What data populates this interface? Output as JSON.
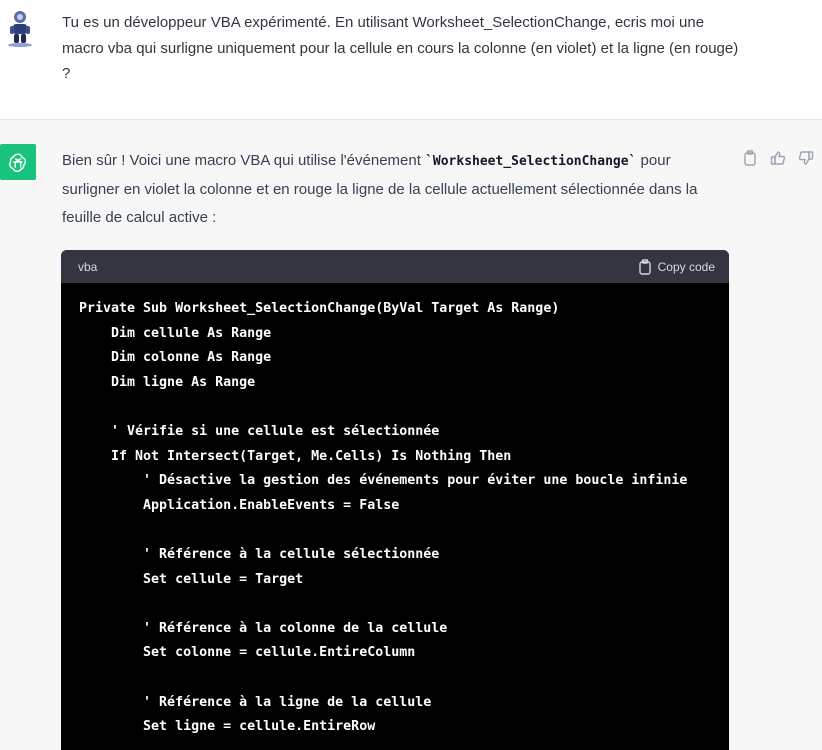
{
  "user_message": {
    "text": "Tu es un développeur VBA expérimenté. En utilisant Worksheet_SelectionChange, ecris moi une macro vba qui surligne uniquement pour la cellule en cours la colonne (en violet) et la ligne (en rouge) ?"
  },
  "assistant_message": {
    "intro_before": "Bien sûr ! Voici une macro VBA qui utilise l'événement ",
    "intro_code": "`Worksheet_SelectionChange`",
    "intro_after": " pour surligner en violet la colonne et en rouge la ligne de la cellule actuellement sélectionnée dans la feuille de calcul active :",
    "actions": [
      "copy-icon",
      "thumbs-up-icon",
      "thumbs-down-icon"
    ]
  },
  "code_block": {
    "language": "vba",
    "copy_label": "Copy code",
    "lines": [
      "Private Sub Worksheet_SelectionChange(ByVal Target As Range)",
      "    Dim cellule As Range",
      "    Dim colonne As Range",
      "    Dim ligne As Range",
      "",
      "    ' Vérifie si une cellule est sélectionnée",
      "    If Not Intersect(Target, Me.Cells) Is Nothing Then",
      "        ' Désactive la gestion des événements pour éviter une boucle infinie",
      "        Application.EnableEvents = False",
      "",
      "        ' Référence à la cellule sélectionnée",
      "        Set cellule = Target",
      "",
      "        ' Référence à la colonne de la cellule",
      "        Set colonne = cellule.EntireColumn",
      "",
      "        ' Référence à la ligne de la cellule",
      "        Set ligne = cellule.EntireRow"
    ]
  },
  "colors": {
    "gpt_green": "#19c37d",
    "code_bg": "#000000",
    "code_header_bg": "#343541"
  }
}
